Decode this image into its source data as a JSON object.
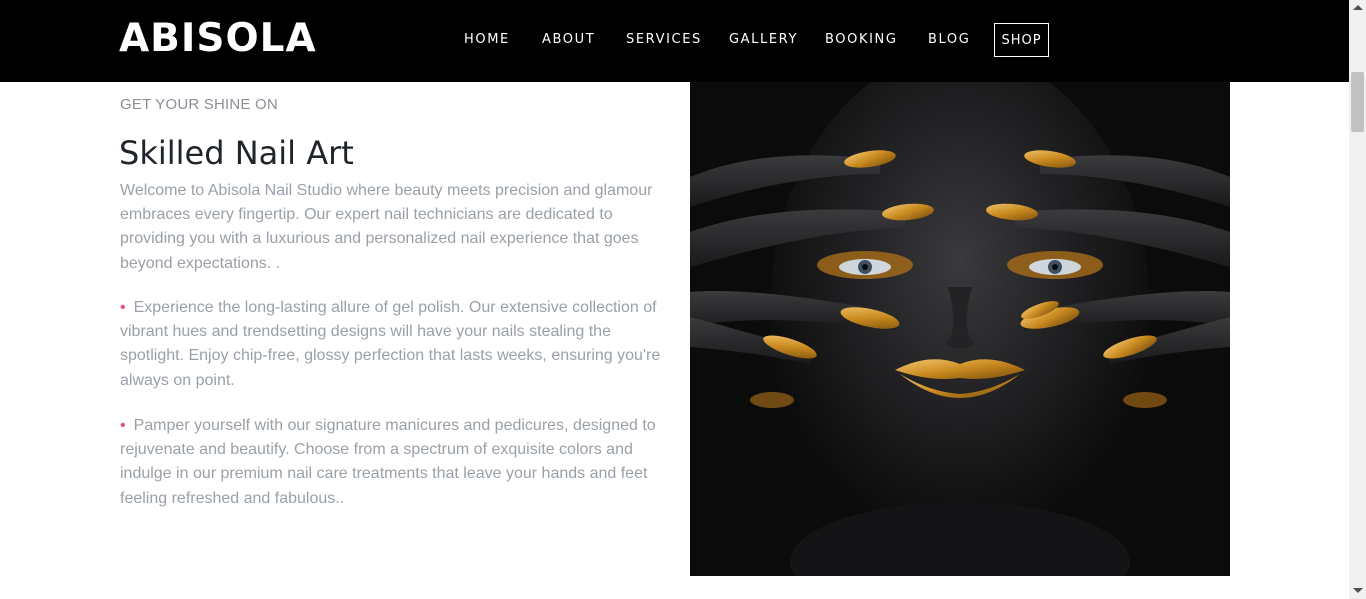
{
  "header": {
    "logo": "ABISOLA",
    "nav": [
      {
        "label": "HOME"
      },
      {
        "label": "ABOUT"
      },
      {
        "label": "SERVICES"
      },
      {
        "label": "GALLERY"
      },
      {
        "label": "BOOKING"
      },
      {
        "label": "BLOG"
      }
    ],
    "shop_label": "SHOP"
  },
  "content": {
    "eyebrow": "GET YOUR SHINE ON",
    "title": "Skilled Nail Art",
    "intro": "Welcome to Abisola Nail Studio where beauty meets precision and glamour embraces every fingertip. Our expert nail technicians are dedicated to providing you with a luxurious and personalized nail experience that goes beyond expectations. .",
    "bullets": [
      {
        "text": "Experience the long-lasting allure of gel polish. Our extensive collection of vibrant hues and trendsetting designs will have your nails stealing the spotlight. Enjoy chip-free, glossy perfection that lasts weeks, ensuring you're always on point."
      },
      {
        "text": "Pamper yourself with our signature manicures and pedicures, designed to rejuvenate and beautify. Choose from a spectrum of exquisite colors and indulge in our premium nail care treatments that leave your hands and feet feeling refreshed and fabulous.."
      }
    ],
    "bullet_glyph": "•"
  },
  "hero": {
    "icon": "portrait-gold-nails-image"
  },
  "colors": {
    "header_bg": "#000000",
    "accent_bullet": "#e84d8a",
    "body_text": "#9aa0a8",
    "title_text": "#1f232a",
    "gold": "#d49a2a"
  }
}
